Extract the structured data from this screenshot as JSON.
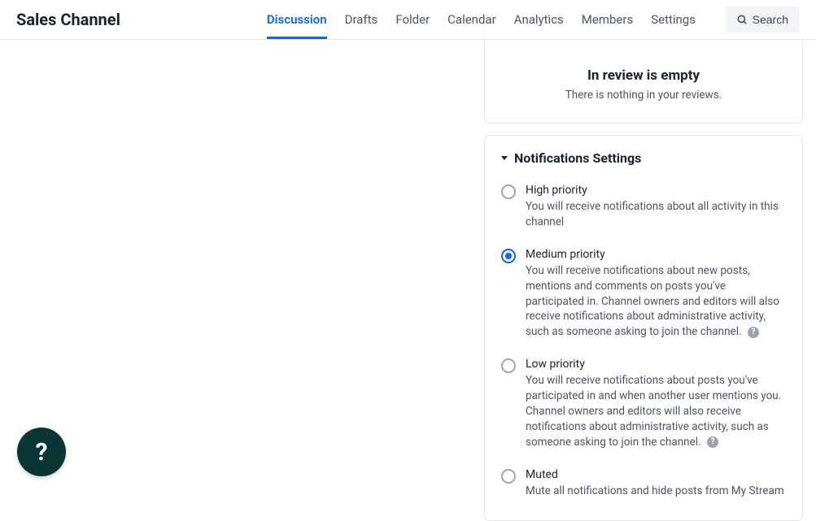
{
  "header": {
    "title": "Sales Channel",
    "nav": [
      {
        "label": "Discussion",
        "active": true
      },
      {
        "label": "Drafts",
        "active": false
      },
      {
        "label": "Folder",
        "active": false
      },
      {
        "label": "Calendar",
        "active": false
      },
      {
        "label": "Analytics",
        "active": false
      },
      {
        "label": "Members",
        "active": false
      },
      {
        "label": "Settings",
        "active": false
      }
    ],
    "search_label": "Search"
  },
  "review": {
    "title": "In review is empty",
    "subtitle": "There is nothing in your reviews."
  },
  "notifications": {
    "title": "Notifications Settings",
    "options": [
      {
        "title": "High priority",
        "desc": "You will receive notifications about all activity in this channel",
        "selected": false,
        "help": false
      },
      {
        "title": "Medium priority",
        "desc": "You will receive notifications about new posts, mentions and comments on posts you've participated in. Channel owners and editors will also receive notifications about administrative activity, such as someone asking to join the channel.",
        "selected": true,
        "help": true
      },
      {
        "title": "Low priority",
        "desc": "You will receive notifications about posts you've participated in and when another user mentions you. Channel owners and editors will also receive notifications about administrative activity, such as someone asking to join the channel.",
        "selected": false,
        "help": true
      },
      {
        "title": "Muted",
        "desc": "Mute all notifications and hide posts from My Stream",
        "selected": false,
        "help": false
      }
    ]
  },
  "help_glyph": "?"
}
